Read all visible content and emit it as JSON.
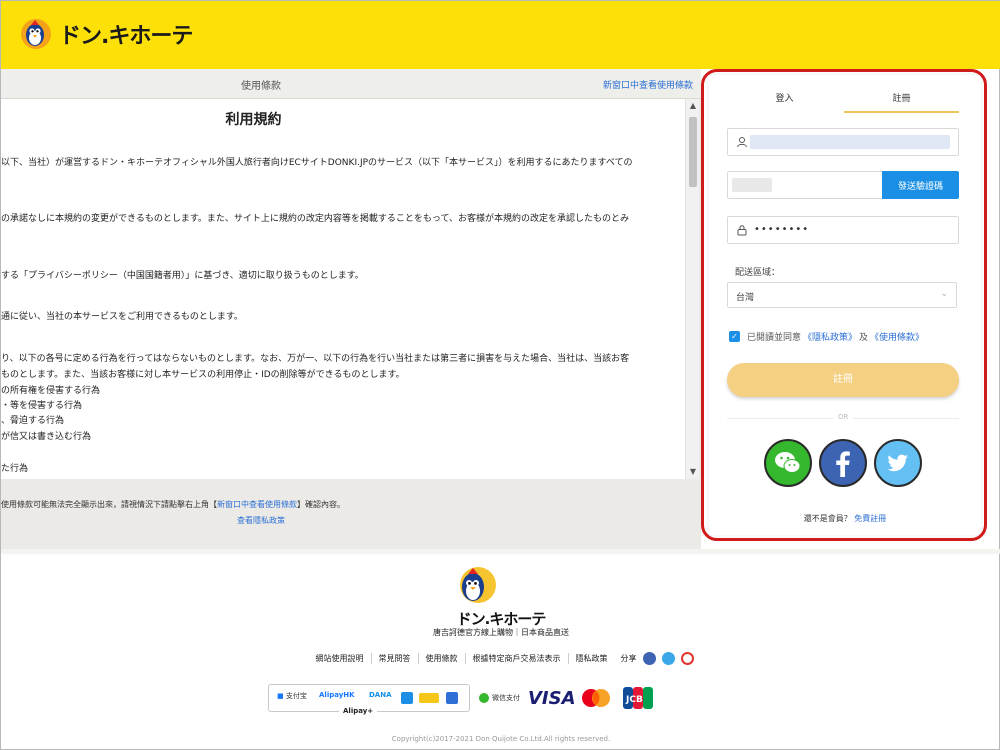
{
  "header": {
    "logo_text": "ドン.キホーテ"
  },
  "terms": {
    "header_title": "使用條款",
    "header_link": "新窗口中查看使用條款",
    "doc_title": "利用規約",
    "lines": [
      "以下、当社）が運営するドン・キホーテオフィシャル外国人旅行者向けECサイトDONKI.JPのサービス（以下「本サービス」）を利用するにあたりますべての",
      "の承諾なしに本規約の変更ができるものとします。また、サイト上に規約の改定内容等を掲載することをもって、お客様が本規約の改定を承認したものとみ",
      "する「プライバシーポリシー（中国国籍者用）」に基づき、適切に取り扱うものとします。",
      "通に従い、当社の本サービスをご利用できるものとします。",
      "り、以下の各号に定める行為を行ってはならないものとします。なお、万が一、以下の行為を行い当社または第三者に損害を与えた場合、当社は、当該お客",
      "ものとします。また、当該お客様に対し本サービスの利用停止・IDの削除等ができるものとします。",
      "の所有権を侵害する行為",
      "・等を侵害する行為",
      "、脅迫する行為",
      "が信又は書き込む行為",
      "た行為"
    ],
    "footnote_prefix": "使用條款可能無法完全顯示出來，請視情況下請點擊右上角【",
    "footnote_link": "新窗口中查看使用條款",
    "footnote_suffix": "】確認內容。",
    "footlink": "查看隱私政策"
  },
  "register": {
    "tab_login": "登入",
    "tab_register": "註冊",
    "send_code": "發送驗證碼",
    "password_mask": "••••••••",
    "region_label": "配送區域：",
    "region_value": "台灣",
    "agree_text": "已閱讀並同意",
    "privacy_link": "《隱私政策》",
    "and": "及",
    "terms_link": "《使用條款》",
    "register_button": "註冊",
    "or": "OR",
    "not_member": "還不是會員？",
    "free_register": "免費註冊"
  },
  "footer": {
    "brand": "ドン.キホーテ",
    "tagline": "唐吉訶德官方線上購物｜日本商品直送",
    "nav": [
      "網站使用說明",
      "常見問答",
      "使用條款",
      "根據特定商戶交易法表示",
      "隱私政策"
    ],
    "share_label": "分享",
    "payments": {
      "alipay_cn": "支付宝",
      "alipay_hk": "AlipayHK",
      "dana": "DANA",
      "alipay_plus": "Alipay+",
      "wechat_pay": "微信支付",
      "visa": "VISA",
      "jcb": "JCB"
    },
    "copyright": "Copyright(c)2017-2021 Don Quijote Co.Ltd.All rights reserved."
  },
  "colors": {
    "header_bg": "#fde007",
    "accent_blue": "#1a8fe5",
    "register_button": "#f5cf82",
    "highlight_outline": "#d11a1a"
  },
  "icons": [
    "user-icon",
    "lock-icon",
    "chevron-down-icon",
    "check-icon",
    "wechat-icon",
    "facebook-icon",
    "twitter-icon",
    "penguin-logo"
  ]
}
